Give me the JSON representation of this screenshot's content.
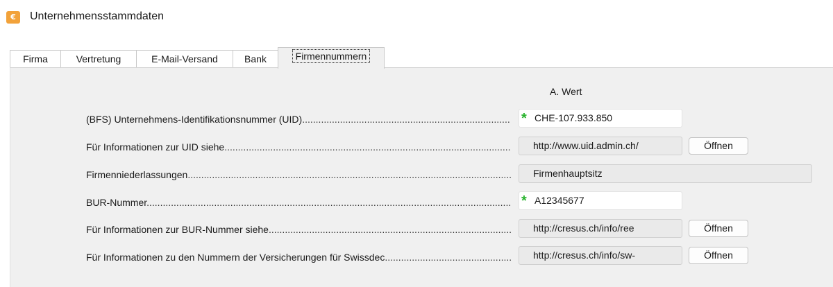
{
  "window": {
    "title": "Unternehmensstammdaten",
    "icon": "app-logo-icon"
  },
  "tabs": [
    {
      "label": "Firma",
      "active": false
    },
    {
      "label": "Vertretung",
      "active": false
    },
    {
      "label": "E-Mail-Versand",
      "active": false
    },
    {
      "label": "Bank",
      "active": false
    },
    {
      "label": "Firmennummern",
      "active": true
    }
  ],
  "column_header": "A. Wert",
  "rows": [
    {
      "label": "(BFS) Unternehmens-Identifikationsnummer (UID)",
      "value": "CHE-107.933.850",
      "required": true
    },
    {
      "label": "Für Informationen zur UID siehe",
      "value": "http://www.uid.admin.ch/",
      "button": "Öffnen"
    },
    {
      "label": "Firmenniederlassungen",
      "value": "Firmenhauptsitz"
    },
    {
      "label": "BUR-Nummer",
      "value": "A12345677",
      "required": true
    },
    {
      "label": "Für Informationen zur BUR-Nummer siehe",
      "value": "http://cresus.ch/info/ree",
      "button": "Öffnen"
    },
    {
      "label": "Für Informationen zu den Nummern der Versicherungen für Swissdec",
      "value": "http://cresus.ch/info/sw-",
      "button": "Öffnen"
    }
  ],
  "colors": {
    "required_marker": "#29b32e",
    "panel_bg": "#f0f0f0",
    "icon_orange": "#f2a23a"
  }
}
